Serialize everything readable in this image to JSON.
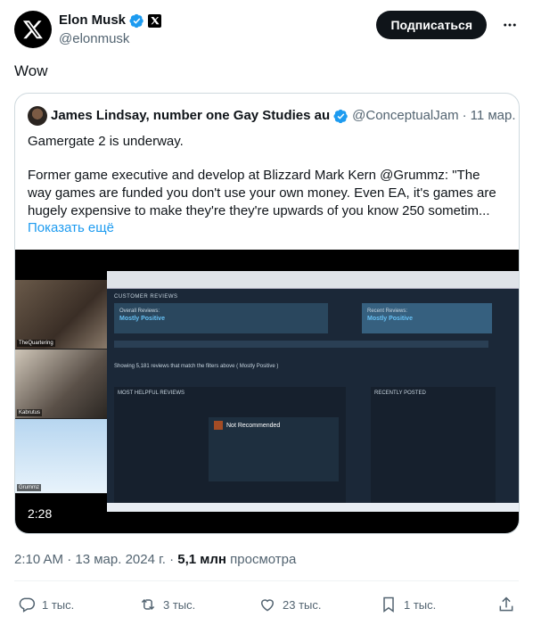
{
  "author": {
    "name": "Elon Musk",
    "handle": "@elonmusk",
    "avatar_icon": "x-logo-icon",
    "verified_icon": "verified-badge-icon",
    "affiliate_icon": "x-affiliate-badge-icon"
  },
  "header": {
    "subscribe_label": "Подписаться",
    "more_icon": "more-horizontal-icon"
  },
  "tweet": {
    "text": "Wow"
  },
  "quote": {
    "name": "James Lindsay, number one Gay Studies au",
    "handle": "@ConceptualJam",
    "separator": "·",
    "date": "11 мар.",
    "line1": "Gamergate 2 is underway.",
    "body": "Former game executive and develop at Blizzard Mark Kern @Grummz: \"The way games are funded you don't use your own money. Even EA, it's games are hugely expensive to make they're they're upwards of you know 250 sometim...",
    "show_more": "Показать ещё",
    "video": {
      "duration": "2:28",
      "cam_labels": [
        "TheQuartering",
        "Kabrutus",
        "Grummz"
      ],
      "screen": {
        "section_title": "CUSTOMER REVIEWS",
        "overall_label": "Overall Reviews:",
        "overall_value": "Mostly Positive",
        "recent_label": "Recent Reviews:",
        "recent_value": "Mostly Positive",
        "filter_count": "Showing 5,181 reviews that match the filters above ( Mostly Positive )",
        "most_helpful": "MOST HELPFUL REVIEWS",
        "recently_posted": "RECENTLY POSTED",
        "review_verdict": "Not Recommended"
      }
    }
  },
  "meta": {
    "time": "2:10 AM",
    "sep": "·",
    "date": "13 мар. 2024 г.",
    "views_count": "5,1 млн",
    "views_label": "просмотра"
  },
  "actions": {
    "replies": "1 тыс.",
    "reposts": "3 тыс.",
    "likes": "23 тыс.",
    "bookmarks": "1 тыс."
  },
  "colors": {
    "accent": "#1d9bf0",
    "text": "#0f1419",
    "secondary": "#536471",
    "border": "#cfd9de"
  }
}
